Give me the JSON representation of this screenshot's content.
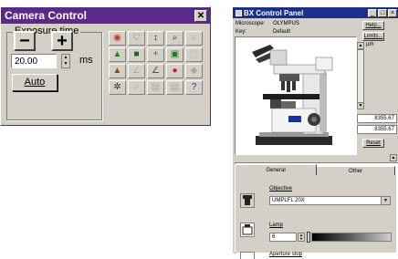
{
  "camera": {
    "title": "Camera Control",
    "close_glyph": "✕",
    "exposure": {
      "label": "Exposure time",
      "minus": "−",
      "plus": "+",
      "value": "20.00",
      "unit": "ms",
      "auto_label": "Auto"
    },
    "tools": [
      {
        "name": "color-wheel-icon",
        "glyph": "◉",
        "color": "#d03020"
      },
      {
        "name": "lasso-icon",
        "glyph": "♡",
        "color": "#606060"
      },
      {
        "name": "histogram-icon",
        "glyph": "↕",
        "color": "#303030"
      },
      {
        "name": "zoom-icon",
        "glyph": "⌕",
        "color": "#303030"
      },
      {
        "name": "dim-tool-icon",
        "glyph": "⌕",
        "color": "#a8a8a8"
      },
      {
        "name": "auto-level-icon",
        "glyph": "▲",
        "color": "#208020"
      },
      {
        "name": "image-icon",
        "glyph": "■",
        "color": "#206020"
      },
      {
        "name": "crosshair-icon",
        "glyph": "+",
        "color": "#208020"
      },
      {
        "name": "frame-icon",
        "glyph": "▣",
        "color": "#208020"
      },
      {
        "name": "dim-tool-icon",
        "glyph": "⬚",
        "color": "#a8a8a8"
      },
      {
        "name": "landscape-icon",
        "glyph": "▲",
        "color": "#8a4a10"
      },
      {
        "name": "dim-tool-icon",
        "glyph": "∠",
        "color": "#a8a8a8"
      },
      {
        "name": "curve-icon",
        "glyph": "∠",
        "color": "#505050"
      },
      {
        "name": "color-balance-icon",
        "glyph": "●",
        "color": "#c02020"
      },
      {
        "name": "dim-tool-icon",
        "glyph": "◆",
        "color": "#a8a8a8"
      },
      {
        "name": "gear-icon",
        "glyph": "✲",
        "color": "#303030"
      },
      {
        "name": "dim-tool-icon",
        "glyph": "⌕",
        "color": "#a8a8a8"
      },
      {
        "name": "dim-tool-icon",
        "glyph": "▤",
        "color": "#a8a8a8"
      },
      {
        "name": "dim-tool-icon",
        "glyph": "▤",
        "color": "#a8a8a8"
      },
      {
        "name": "help-icon",
        "glyph": "?",
        "color": "#1c2fa0"
      }
    ]
  },
  "bx": {
    "title": "BX Control Panel",
    "title_buttons": [
      "_",
      "□",
      "×"
    ],
    "microscope_label": "Microscope:",
    "microscope_value": "OLYMPUS",
    "key_label": "Key:",
    "key_value": "Default",
    "help_button": "Help...",
    "limits_button": "Limits...",
    "z_unit": "µm",
    "z_value_1": "8355.67",
    "z_value_2": "8355.67",
    "reset_button": "Reset",
    "tabs": [
      "General",
      "Other"
    ],
    "objective_label": "Objective",
    "objective_value": "UMPLFL 20X",
    "lamp_label": "Lamp",
    "lamp_value": "6",
    "aperture_label": "Aperture stop"
  }
}
